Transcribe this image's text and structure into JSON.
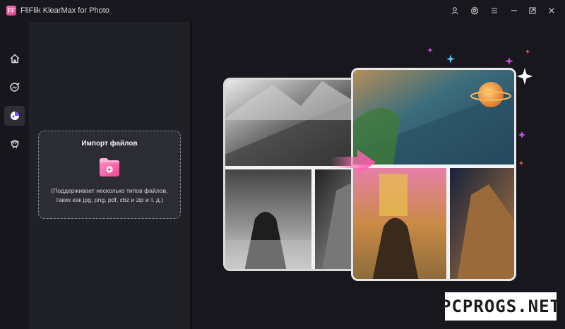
{
  "window": {
    "title": "FliFlik KlearMax for Photo",
    "logo_text": "FF"
  },
  "titlebar_buttons": [
    {
      "name": "account-icon"
    },
    {
      "name": "settings-icon"
    },
    {
      "name": "menu-icon"
    },
    {
      "name": "minimize-icon"
    },
    {
      "name": "maximize-icon"
    },
    {
      "name": "close-icon"
    }
  ],
  "rail": {
    "items": [
      {
        "name": "home-icon",
        "active": false
      },
      {
        "name": "photo-enhance-icon",
        "active": false
      },
      {
        "name": "anime-colorize-icon",
        "active": true
      },
      {
        "name": "face-enhance-icon",
        "active": false
      }
    ]
  },
  "import": {
    "title": "Импорт файлов",
    "description": "(Поддерживает несколько типов файлов, таких как jpg, png, pdf, cbz и zip и т. д.)"
  },
  "colors": {
    "accent": "#ff5fa8",
    "background": "#16161c",
    "panel": "#202027",
    "dropzone": "#2c2c34"
  },
  "watermark": {
    "text": "PCPROGS.NET"
  }
}
